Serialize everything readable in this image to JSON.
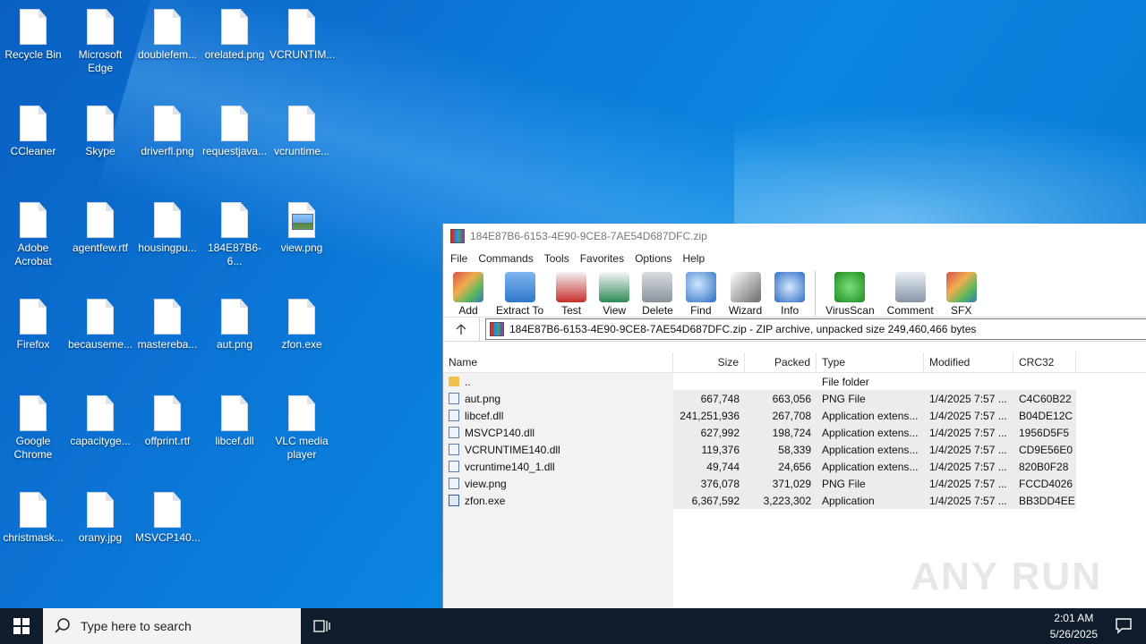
{
  "desktop": {
    "icons": [
      {
        "label": "Recycle Bin",
        "kind": "file"
      },
      {
        "label": "Microsoft Edge",
        "kind": "file"
      },
      {
        "label": "doublefem...",
        "kind": "file"
      },
      {
        "label": "orelated.png",
        "kind": "file"
      },
      {
        "label": "VCRUNTIM...",
        "kind": "file"
      },
      {
        "label": "CCleaner",
        "kind": "file"
      },
      {
        "label": "Skype",
        "kind": "file"
      },
      {
        "label": "driverfl.png",
        "kind": "file"
      },
      {
        "label": "requestjava...",
        "kind": "file"
      },
      {
        "label": "vcruntime...",
        "kind": "file"
      },
      {
        "label": "Adobe Acrobat",
        "kind": "file"
      },
      {
        "label": "agentfew.rtf",
        "kind": "file"
      },
      {
        "label": "housingpu...",
        "kind": "file"
      },
      {
        "label": "184E87B6-6...",
        "kind": "file"
      },
      {
        "label": "view.png",
        "kind": "img"
      },
      {
        "label": "Firefox",
        "kind": "file"
      },
      {
        "label": "becauseme...",
        "kind": "file"
      },
      {
        "label": "mastereba...",
        "kind": "file"
      },
      {
        "label": "aut.png",
        "kind": "file"
      },
      {
        "label": "zfon.exe",
        "kind": "file"
      },
      {
        "label": "Google Chrome",
        "kind": "file"
      },
      {
        "label": "capacityge...",
        "kind": "file"
      },
      {
        "label": "offprint.rtf",
        "kind": "file"
      },
      {
        "label": "libcef.dll",
        "kind": "file"
      },
      {
        "label": "VLC media player",
        "kind": "file"
      },
      {
        "label": "christmask...",
        "kind": "file"
      },
      {
        "label": "orany.jpg",
        "kind": "file"
      },
      {
        "label": "MSVCP140...",
        "kind": "file"
      }
    ]
  },
  "window": {
    "title": "184E87B6-6153-4E90-9CE8-7AE54D687DFC.zip",
    "menu": [
      "File",
      "Commands",
      "Tools",
      "Favorites",
      "Options",
      "Help"
    ],
    "toolbar": [
      {
        "label": "Add",
        "icon": "add-icon"
      },
      {
        "label": "Extract To",
        "icon": "extract-icon"
      },
      {
        "label": "Test",
        "icon": "test-icon"
      },
      {
        "label": "View",
        "icon": "view-icon"
      },
      {
        "label": "Delete",
        "icon": "delete-icon"
      },
      {
        "label": "Find",
        "icon": "find-icon"
      },
      {
        "label": "Wizard",
        "icon": "wizard-icon"
      },
      {
        "label": "Info",
        "icon": "info-icon"
      },
      {
        "label": "VirusScan",
        "icon": "virusscan-icon"
      },
      {
        "label": "Comment",
        "icon": "comment-icon"
      },
      {
        "label": "SFX",
        "icon": "sfx-icon"
      }
    ],
    "address": "184E87B6-6153-4E90-9CE8-7AE54D687DFC.zip - ZIP archive, unpacked size 249,460,466 bytes",
    "columns": {
      "name": "Name",
      "size": "Size",
      "packed": "Packed",
      "type": "Type",
      "modified": "Modified",
      "crc": "CRC32"
    },
    "rows": [
      {
        "name": "..",
        "size": "",
        "packed": "",
        "type": "File folder",
        "modified": "",
        "crc": "",
        "kind": "folder"
      },
      {
        "name": "aut.png",
        "size": "667,748",
        "packed": "663,056",
        "type": "PNG File",
        "modified": "1/4/2025 7:57 ...",
        "crc": "C4C60B22",
        "kind": "file"
      },
      {
        "name": "libcef.dll",
        "size": "241,251,936",
        "packed": "267,708",
        "type": "Application extens...",
        "modified": "1/4/2025 7:57 ...",
        "crc": "B04DE12C",
        "kind": "file"
      },
      {
        "name": "MSVCP140.dll",
        "size": "627,992",
        "packed": "198,724",
        "type": "Application extens...",
        "modified": "1/4/2025 7:57 ...",
        "crc": "1956D5F5",
        "kind": "file"
      },
      {
        "name": "VCRUNTIME140.dll",
        "size": "119,376",
        "packed": "58,339",
        "type": "Application extens...",
        "modified": "1/4/2025 7:57 ...",
        "crc": "CD9E56E0",
        "kind": "file"
      },
      {
        "name": "vcruntime140_1.dll",
        "size": "49,744",
        "packed": "24,656",
        "type": "Application extens...",
        "modified": "1/4/2025 7:57 ...",
        "crc": "820B0F28",
        "kind": "file"
      },
      {
        "name": "view.png",
        "size": "376,078",
        "packed": "371,029",
        "type": "PNG File",
        "modified": "1/4/2025 7:57 ...",
        "crc": "FCCD4026",
        "kind": "file"
      },
      {
        "name": "zfon.exe",
        "size": "6,367,592",
        "packed": "3,223,302",
        "type": "Application",
        "modified": "1/4/2025 7:57 ...",
        "crc": "BB3DD4EE",
        "kind": "exe"
      }
    ]
  },
  "watermark": "ANY RUN",
  "taskbar": {
    "search_placeholder": "Type here to search",
    "time": "2:01 AM",
    "date": "5/26/2025"
  }
}
